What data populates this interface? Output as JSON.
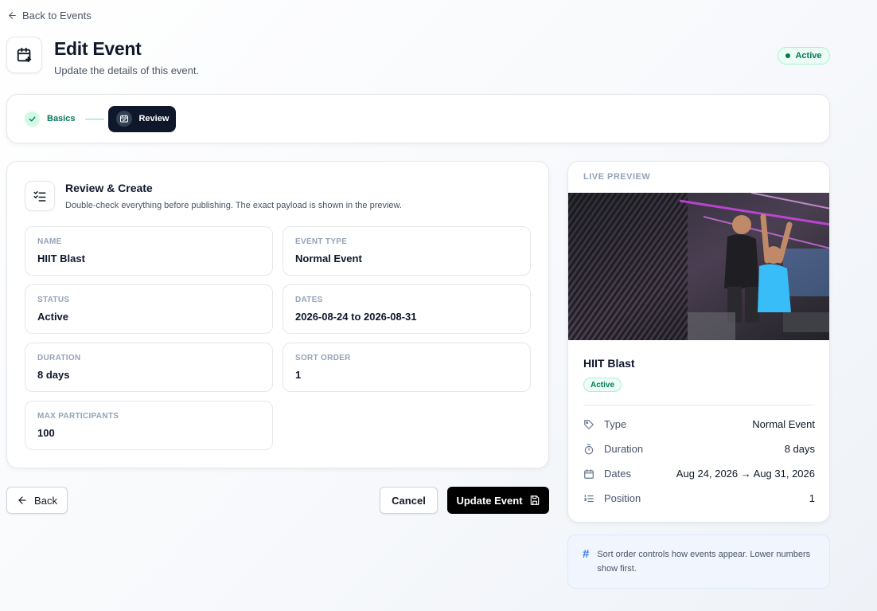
{
  "nav": {
    "back_to_events": "Back to Events"
  },
  "header": {
    "title": "Edit Event",
    "subtitle": "Update the details of this event.",
    "status": "Active"
  },
  "stepper": {
    "steps": [
      {
        "label": "Basics",
        "state": "complete"
      },
      {
        "label": "Review",
        "state": "active"
      }
    ]
  },
  "review": {
    "title": "Review & Create",
    "subtitle": "Double-check everything before publishing. The exact payload is shown in the preview.",
    "fields": [
      {
        "label": "NAME",
        "value": "HIIT Blast"
      },
      {
        "label": "EVENT TYPE",
        "value": "Normal Event"
      },
      {
        "label": "STATUS",
        "value": "Active"
      },
      {
        "label": "DATES",
        "value": "2026-08-24 to 2026-08-31"
      },
      {
        "label": "DURATION",
        "value": "8 days"
      },
      {
        "label": "SORT ORDER",
        "value": "1"
      },
      {
        "label": "MAX PARTICIPANTS",
        "value": "100"
      }
    ]
  },
  "actions": {
    "back": "Back",
    "cancel": "Cancel",
    "update": "Update Event"
  },
  "preview": {
    "label": "LIVE PREVIEW",
    "name": "HIIT Blast",
    "badge": "Active",
    "rows": [
      {
        "label": "Type",
        "value": "Normal Event",
        "icon": "tag-icon"
      },
      {
        "label": "Duration",
        "value": "8 days",
        "icon": "timer-icon"
      },
      {
        "label": "Dates",
        "value": "Aug 24, 2026 → Aug 31, 2026",
        "icon": "calendar-icon"
      },
      {
        "label": "Position",
        "value": "1",
        "icon": "list-ordered-icon"
      }
    ]
  },
  "hint": {
    "symbol": "#",
    "text": "Sort order controls how events appear. Lower numbers show first."
  },
  "colors": {
    "accent_dark": "#0f172a",
    "success": "#047857",
    "success_bg": "#ecfdf5",
    "border": "#e5e7eb"
  }
}
